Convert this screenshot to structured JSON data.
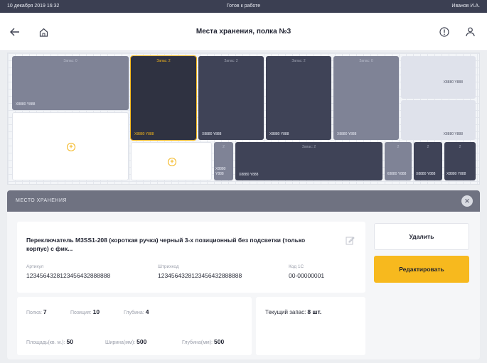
{
  "statusbar": {
    "datetime": "10 декабря 2019 16:32",
    "status": "Готов к работе",
    "user": "Иванов И.А."
  },
  "header": {
    "title": "Места хранения, полка №3"
  },
  "icons": {
    "back": "arrow-left-icon",
    "home": "home-icon",
    "info": "info-icon",
    "profile": "user-icon",
    "add": "plus-circle-icon",
    "close": "close-icon",
    "edit": "edit-icon"
  },
  "colors": {
    "accent": "#f7b91e",
    "highlight_cell": "#2f3241",
    "dark_cell": "#3f4357",
    "medium_cell": "#7f8396",
    "light_cell": "#dfe2eb",
    "panel_header": "#6f7281"
  },
  "grid": {
    "cells": [
      {
        "label": "Запас: 0",
        "code": "X8880 Y888"
      },
      {
        "label": "Запас: 2",
        "code": "X8880 Y888"
      },
      {
        "label": "Запас: 2",
        "code": "X8880 Y888"
      },
      {
        "label": "Запас: 2",
        "code": "X8880 Y888"
      },
      {
        "label": "Запас: 0",
        "code": "X8880 Y888"
      },
      {
        "label": "",
        "code": "X8880 Y888"
      },
      {
        "label": "",
        "code": "X8880 Y888"
      },
      {
        "label": "2",
        "code": "X8880 Y888"
      },
      {
        "label": "Запас: 2",
        "code": "X8880 Y888"
      },
      {
        "label": "2",
        "code": "X8880 Y888"
      },
      {
        "label": "2",
        "code": "X8880 Y888"
      },
      {
        "label": "2",
        "code": "X8880 Y888"
      }
    ]
  },
  "panel": {
    "title": "МЕСТО ХРАНЕНИЯ",
    "product_name": "Переключатель M3SS1-208 (короткая ручка) черный 3-х позиционный без подсветки (только корпус) с фик...",
    "article_label": "Артикул",
    "article_value": "1234564328123456432888888",
    "barcode_label": "Штрихкод",
    "barcode_value": "1234564328123456432888888",
    "code1c_label": "Код 1С",
    "code1c_value": "00-00000001",
    "shelf_label": "Полка:",
    "shelf_value": "7",
    "position_label": "Позиция:",
    "position_value": "10",
    "depth_label": "Глубина:",
    "depth_value": "4",
    "area_label": "Площадь(кв. м.):",
    "area_value": "50",
    "width_label": "Ширина(мм):",
    "width_value": "500",
    "depthmm_label": "Глубина(мм):",
    "depthmm_value": "500",
    "stock_label": "Текущий запас:",
    "stock_value": "8 шт."
  },
  "actions": {
    "delete": "Удалить",
    "edit": "Редактировать"
  }
}
